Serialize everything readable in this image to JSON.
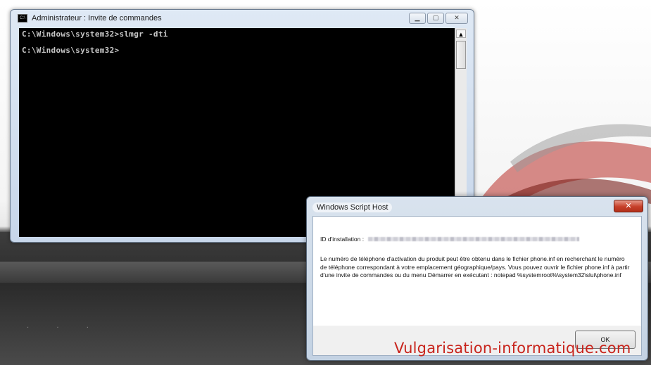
{
  "cmd_window": {
    "title": "Administrateur : Invite de commandes",
    "app_icon_text": "C:\\",
    "lines": [
      "C:\\Windows\\system32>slmgr -dti",
      "C:\\Windows\\system32>"
    ],
    "controls": [
      "minimize-icon",
      "maximize-icon",
      "close-icon"
    ]
  },
  "dialog": {
    "title": "Windows Script Host",
    "close_glyph": "✕",
    "id_label": "ID d'installation :",
    "message": "Le numéro de téléphone d'activation du produit peut être obtenu dans le fichier phone.inf en recherchant le numéro de téléphone correspondant à votre emplacement géographique/pays. Vous pouvez ouvrir le fichier phone.inf à partir d'une invite de commandes ou du menu Démarrer en exécutant : notepad %systemroot%\\system32\\slui\\phone.inf",
    "ok_label": "OK"
  },
  "watermark": "Vulgarisation-informatique.com",
  "colors": {
    "console_bg": "#000000",
    "console_text": "#c8c8c8",
    "watermark": "#c8241c",
    "close_red": "#c6402a"
  }
}
